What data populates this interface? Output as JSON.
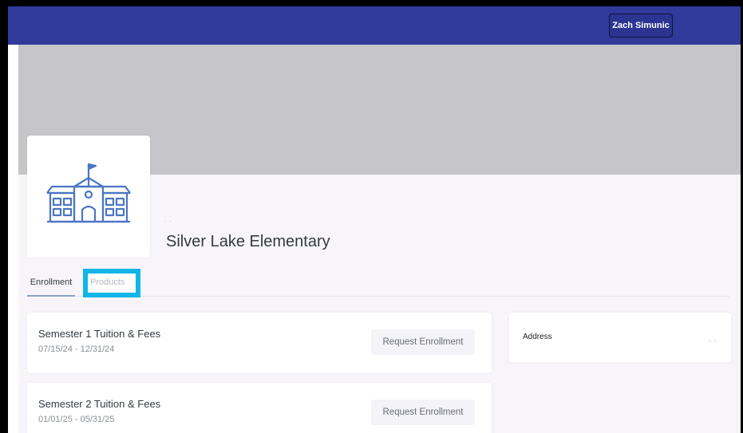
{
  "header": {
    "user_name": "Zach Simunic"
  },
  "school": {
    "name": "Silver Lake Elementary",
    "name_prefix_dots": ". ."
  },
  "tabs": [
    {
      "label": "Enrollment",
      "active": true
    },
    {
      "label": "Products",
      "highlighted": true
    }
  ],
  "products": [
    {
      "title": "Semester 1 Tuition & Fees",
      "dates": "07/15/24 - 12/31/24",
      "action": "Request Enrollment"
    },
    {
      "title": "Semester 2 Tuition & Fees",
      "dates": "01/01/25 - 05/31/25",
      "action": "Request Enrollment"
    }
  ],
  "address": {
    "label": "Address",
    "value": ". ."
  },
  "colors": {
    "header": "#2f3a9b",
    "highlight": "#12b5e6",
    "icon": "#4a76c4",
    "banner": "#c6c5ca"
  },
  "icons": {
    "school_logo": "school-building-icon"
  }
}
